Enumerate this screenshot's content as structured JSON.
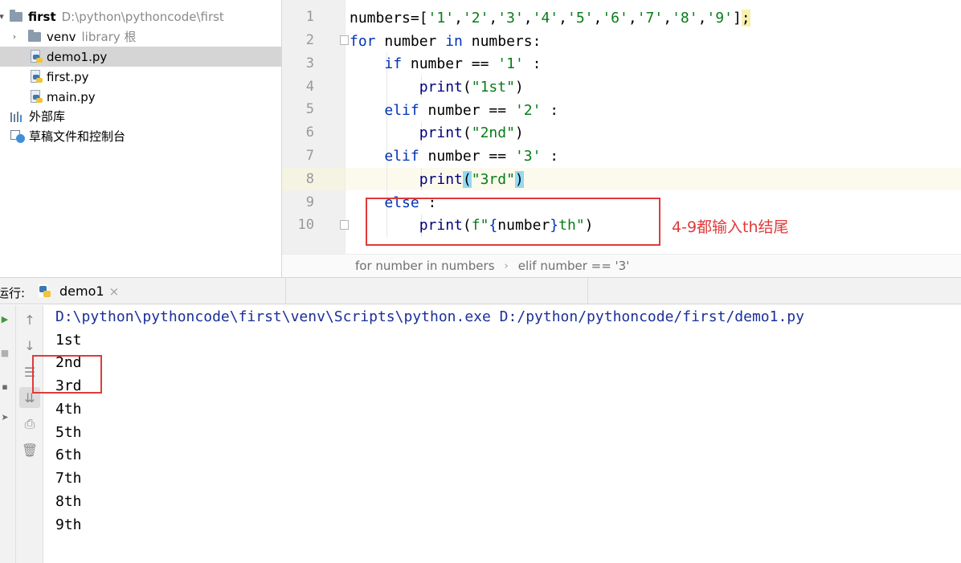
{
  "project": {
    "root": {
      "name": "first",
      "path": "D:\\python\\pythoncode\\first"
    },
    "items": [
      {
        "name": "venv",
        "hint": "library 根",
        "type": "folder"
      },
      {
        "name": "demo1.py",
        "type": "python-file",
        "selected": true
      },
      {
        "name": "first.py",
        "type": "python-file"
      },
      {
        "name": "main.py",
        "type": "python-file"
      }
    ],
    "external_libraries": "外部库",
    "scratches": "草稿文件和控制台"
  },
  "editor": {
    "line_numbers": [
      "1",
      "2",
      "3",
      "4",
      "5",
      "6",
      "7",
      "8",
      "9",
      "10"
    ],
    "code": {
      "l1_var": "numbers",
      "l1_eq": "=[",
      "l1_items": [
        "'1'",
        "'2'",
        "'3'",
        "'4'",
        "'5'",
        "'6'",
        "'7'",
        "'8'",
        "'9'"
      ],
      "l1_end": "]",
      "l1_semi": ";",
      "l2_for": "for",
      "l2_var": " number ",
      "l2_in": "in",
      "l2_rest": " numbers:",
      "l3_if": "if",
      "l3_cond": " number == ",
      "l3_str": "'1'",
      "l3_colon": " :",
      "l4_print": "print",
      "l4_str": "\"1st\"",
      "l5_elif": "elif",
      "l5_cond": " number == ",
      "l5_str": "'2'",
      "l5_colon": " :",
      "l6_print": "print",
      "l6_str": "\"2nd\"",
      "l7_elif": "elif",
      "l7_cond": " number == ",
      "l7_str": "'3'",
      "l7_colon": " :",
      "l8_print": "print",
      "l8_open": "(",
      "l8_str": "\"3rd\"",
      "l8_close": ")",
      "l9_else": "else",
      "l9_colon": " :",
      "l10_print": "print",
      "l10_fpre": "f\"",
      "l10_brace_open": "{",
      "l10_var": "number",
      "l10_brace_close": "}",
      "l10_fpost": "th\"",
      "l10_close": ")"
    },
    "annotation": "4-9都输入th结尾"
  },
  "breadcrumb": [
    "for number in numbers",
    "elif number == '3'"
  ],
  "run": {
    "label": "运行:",
    "tab": "demo1",
    "command": "D:\\python\\pythoncode\\first\\venv\\Scripts\\python.exe D:/python/pythoncode/first/demo1.py",
    "output": [
      "1st",
      "2nd",
      "3rd",
      "4th",
      "5th",
      "6th",
      "7th",
      "8th",
      "9th"
    ],
    "toolbar_icons": [
      "arrow-up-icon",
      "arrow-down-icon",
      "soft-wrap-icon",
      "scroll-to-end-icon",
      "print-icon",
      "trash-icon"
    ]
  },
  "colors": {
    "keyword": "#0033b3",
    "string": "#067d17",
    "annotation": "#e03a3a",
    "console_command": "#1b2f99"
  }
}
